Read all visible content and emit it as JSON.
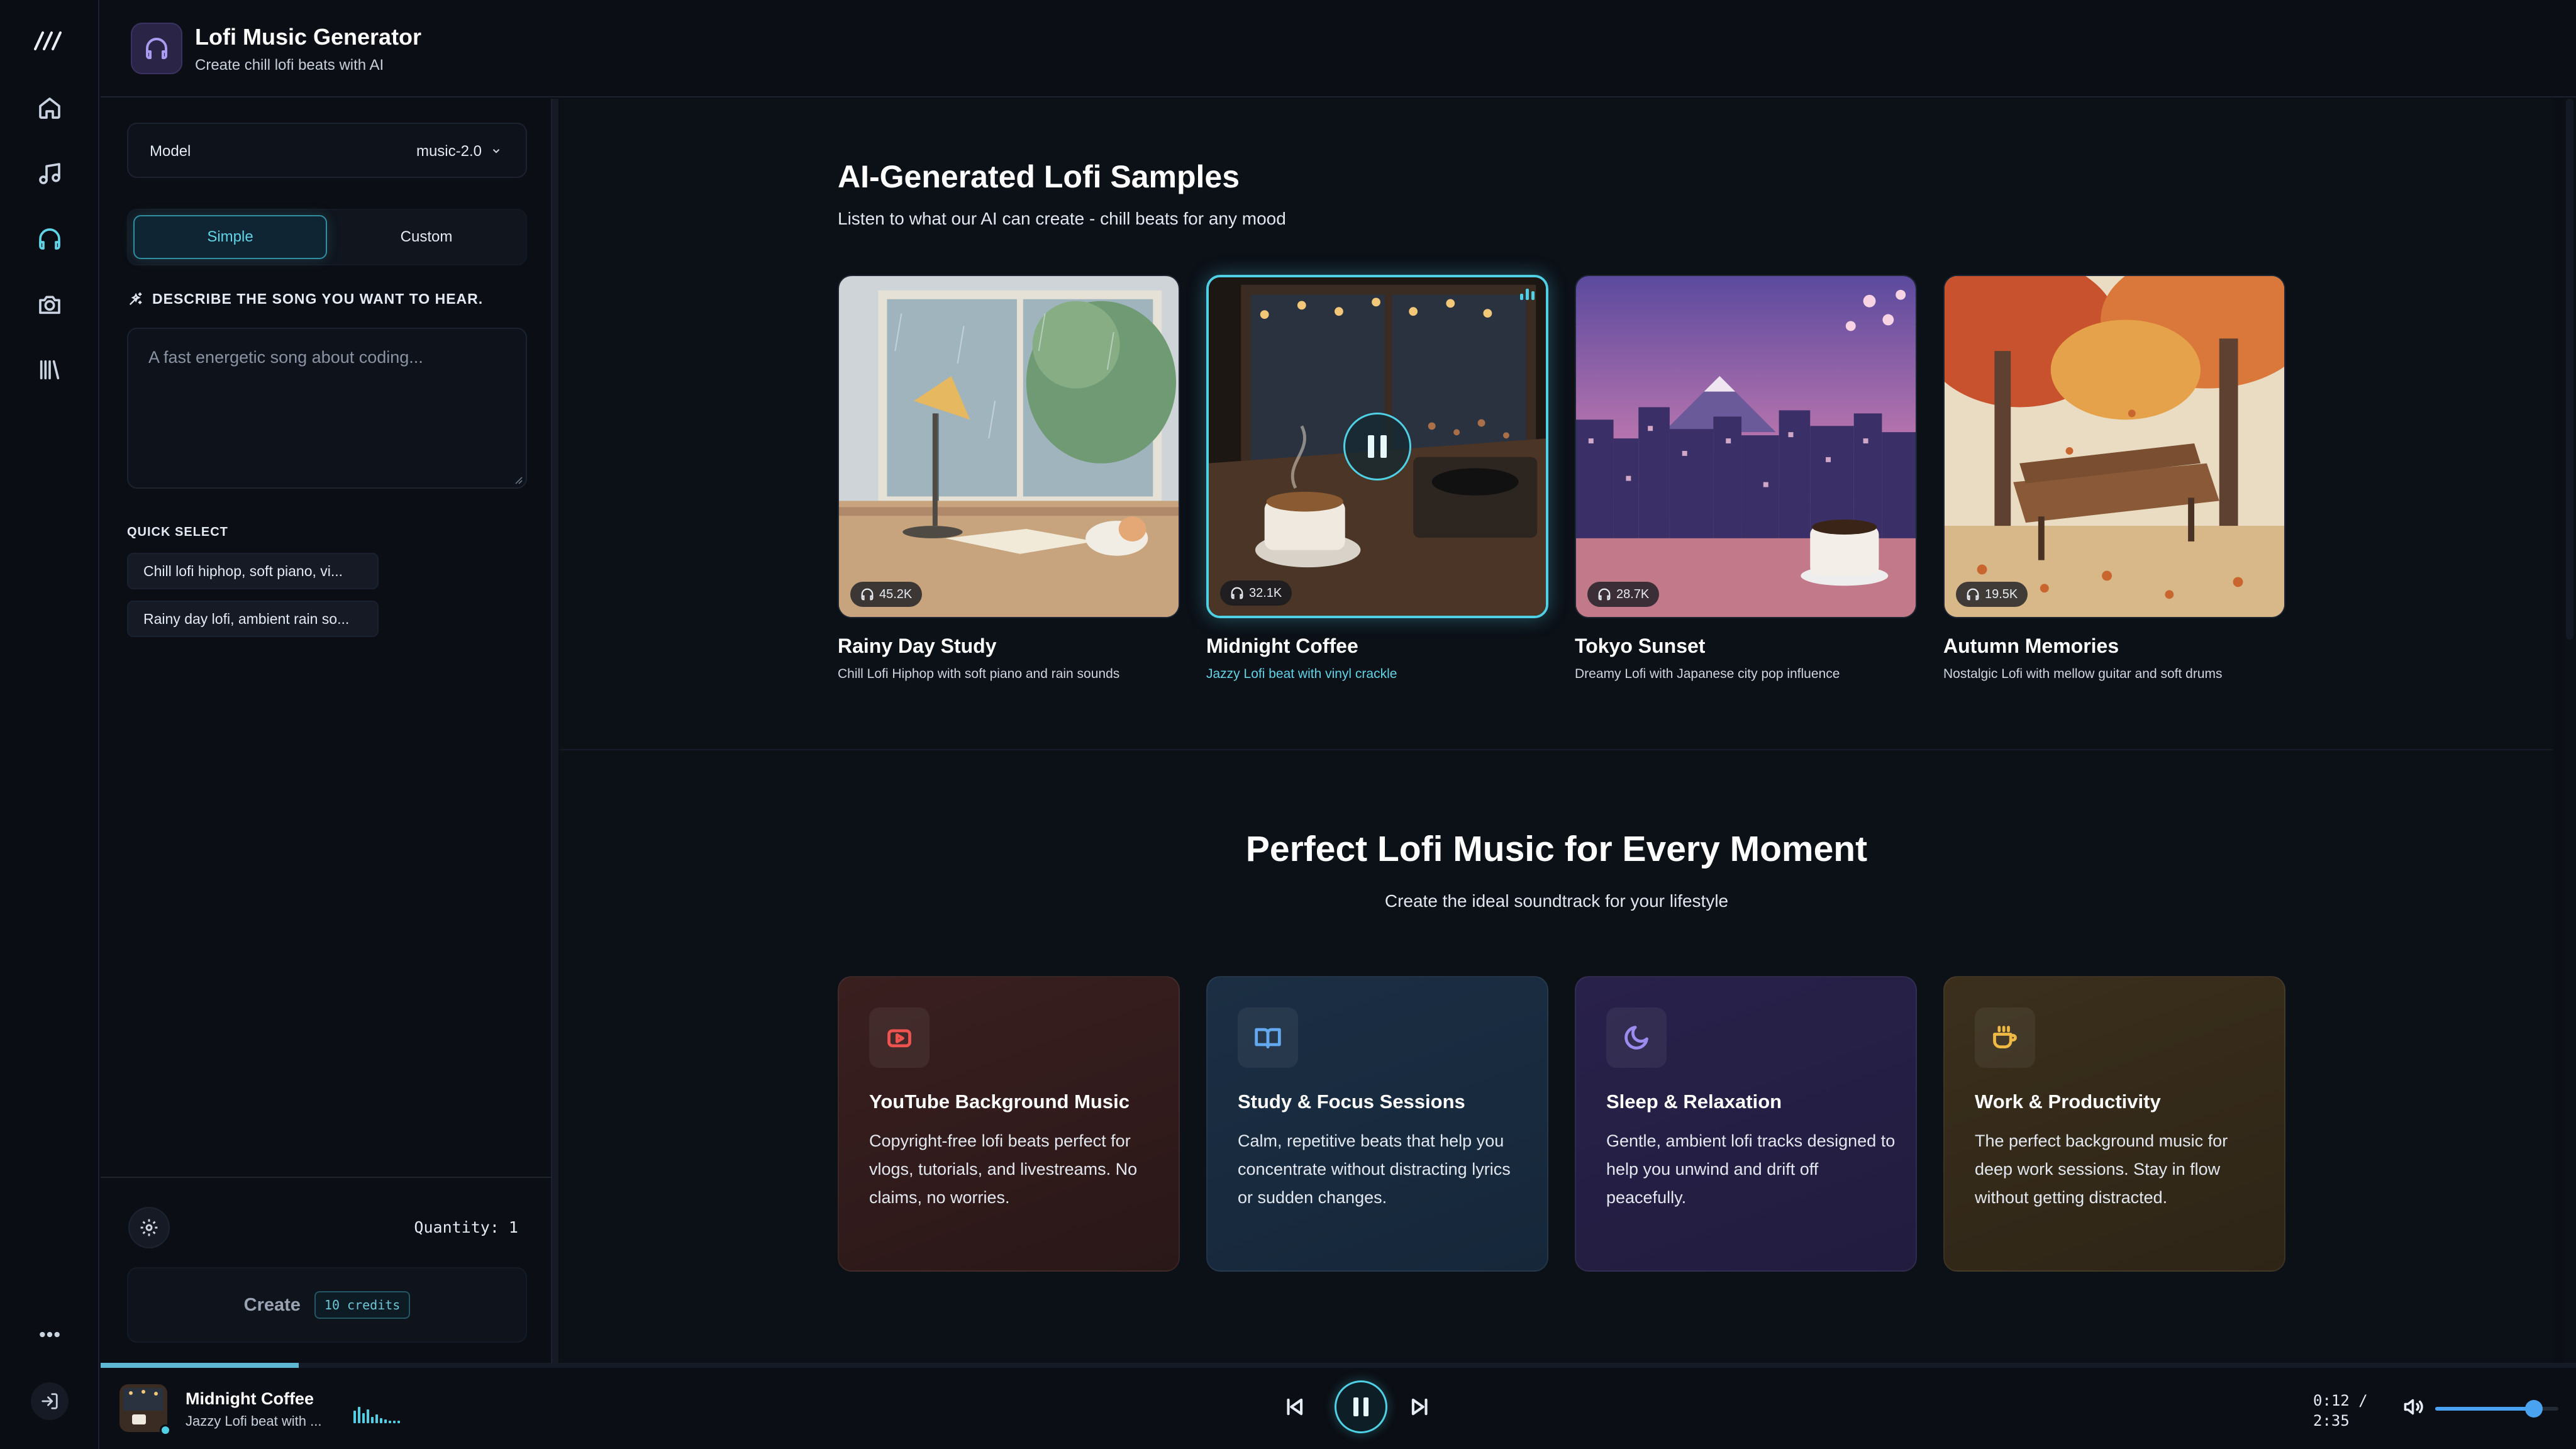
{
  "app": {
    "title": "Lofi Music Generator",
    "subtitle": "Create chill lofi beats with AI",
    "accent_color": "#5fd4e6"
  },
  "rail": {
    "items": [
      {
        "icon": "home-icon",
        "active": false
      },
      {
        "icon": "music-note-icon",
        "active": false
      },
      {
        "icon": "headphones-icon",
        "active": true
      },
      {
        "icon": "camera-icon",
        "active": false
      },
      {
        "icon": "library-icon",
        "active": false
      }
    ],
    "bottom": [
      "more-icon",
      "sign-in-icon"
    ]
  },
  "sidebar": {
    "model_label": "Model",
    "model_value": "music-2.0",
    "tabs": {
      "simple": "Simple",
      "custom": "Custom",
      "selected": "Simple"
    },
    "describe_label": "DESCRIBE THE SONG YOU WANT TO HEAR.",
    "prompt_placeholder": "A fast energetic song about coding...",
    "quick_select_label": "QUICK SELECT",
    "quick_select": [
      "Chill lofi hiphop, soft piano, vi...",
      "Rainy day lofi, ambient rain so..."
    ],
    "quantity": "Quantity: 1",
    "create_label": "Create",
    "credits": "10 credits"
  },
  "samples": {
    "title": "AI-Generated Lofi Samples",
    "subtitle": "Listen to what our AI can create - chill beats for any mood",
    "items": [
      {
        "name": "Rainy Day Study",
        "desc": "Chill Lofi Hiphop with soft piano and rain sounds",
        "plays": "45.2K",
        "playing": false
      },
      {
        "name": "Midnight Coffee",
        "desc": "Jazzy Lofi beat with vinyl crackle",
        "plays": "32.1K",
        "playing": true
      },
      {
        "name": "Tokyo Sunset",
        "desc": "Dreamy Lofi with Japanese city pop influence",
        "plays": "28.7K",
        "playing": false
      },
      {
        "name": "Autumn Memories",
        "desc": "Nostalgic Lofi with mellow guitar and soft drums",
        "plays": "19.5K",
        "playing": false
      }
    ]
  },
  "moments": {
    "title": "Perfect Lofi Music for Every Moment",
    "subtitle": "Create the ideal soundtrack for your lifestyle",
    "items": [
      {
        "icon": "youtube-icon",
        "title": "YouTube Background Music",
        "desc": "Copyright-free lofi beats perfect for vlogs, tutorials, and livestreams. No claims, no worries.",
        "color": "#ef5350"
      },
      {
        "icon": "book-icon",
        "title": "Study & Focus Sessions",
        "desc": "Calm, repetitive beats that help you concentrate without distracting lyrics or sudden changes.",
        "color": "#64a8f0"
      },
      {
        "icon": "moon-icon",
        "title": "Sleep & Relaxation",
        "desc": "Gentle, ambient lofi tracks designed to help you unwind and drift off peacefully.",
        "color": "#9d8cf0"
      },
      {
        "icon": "coffee-icon",
        "title": "Work & Productivity",
        "desc": "The perfect background music for deep work sessions. Stay in flow without getting distracted.",
        "color": "#f0b845"
      }
    ]
  },
  "player": {
    "title": "Midnight Coffee",
    "subtitle": "Jazzy Lofi beat with ...",
    "elapsed": "0:12 /",
    "duration": "2:35",
    "progress": 0.08,
    "volume": 0.8
  }
}
